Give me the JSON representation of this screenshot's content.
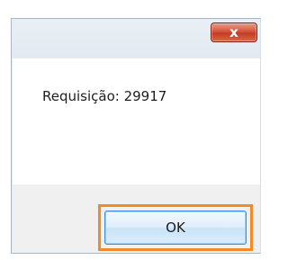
{
  "dialog": {
    "close_glyph": "x",
    "message": "Requisição: 29917",
    "ok_label": "OK"
  },
  "colors": {
    "close_button": "#c9462c",
    "highlight": "#f08b2c",
    "ok_border": "#3d8ee0"
  }
}
